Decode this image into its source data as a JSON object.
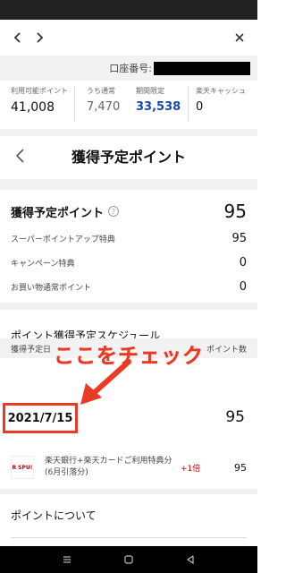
{
  "browser": {
    "back_icon": "chevron-left-icon",
    "forward_icon": "chevron-right-icon",
    "close_icon": "close-icon"
  },
  "account": {
    "label": "口座番号:"
  },
  "summary": {
    "available": {
      "label": "利用可能ポイント",
      "value": "41,008"
    },
    "regular": {
      "label": "うち通常",
      "value": "7,470"
    },
    "limited": {
      "label": "期間限定",
      "value": "33,538"
    },
    "cash": {
      "label": "楽天キャッシュ",
      "value": "0"
    }
  },
  "page": {
    "title": "獲得予定ポイント"
  },
  "totals": {
    "label": "獲得予定ポイント",
    "value": "95",
    "help_icon": "?",
    "breakdown": [
      {
        "label": "スーパーポイントアップ特典",
        "value": "95"
      },
      {
        "label": "キャンペーン特典",
        "value": "0"
      },
      {
        "label": "お買い物通常ポイント",
        "value": "0"
      }
    ]
  },
  "schedule": {
    "title": "ポイント獲得予定スケジュール",
    "col_date": "獲得予定日",
    "col_points": "ポイント数",
    "date": "2021/7/15",
    "date_total": "95",
    "item": {
      "logo": "R SPU!",
      "text": "楽天銀行+楽天カードご利用特典分(6月引落分)",
      "multiplier": "+1倍",
      "points": "95"
    }
  },
  "annotation": {
    "text": "ここをチェック",
    "color": "#e83a24"
  },
  "about": {
    "label": "ポイントについて"
  },
  "colors": {
    "accent_red": "#e83a24",
    "limited_blue": "#1a4aa8",
    "rakuten_red": "#bf0000"
  }
}
